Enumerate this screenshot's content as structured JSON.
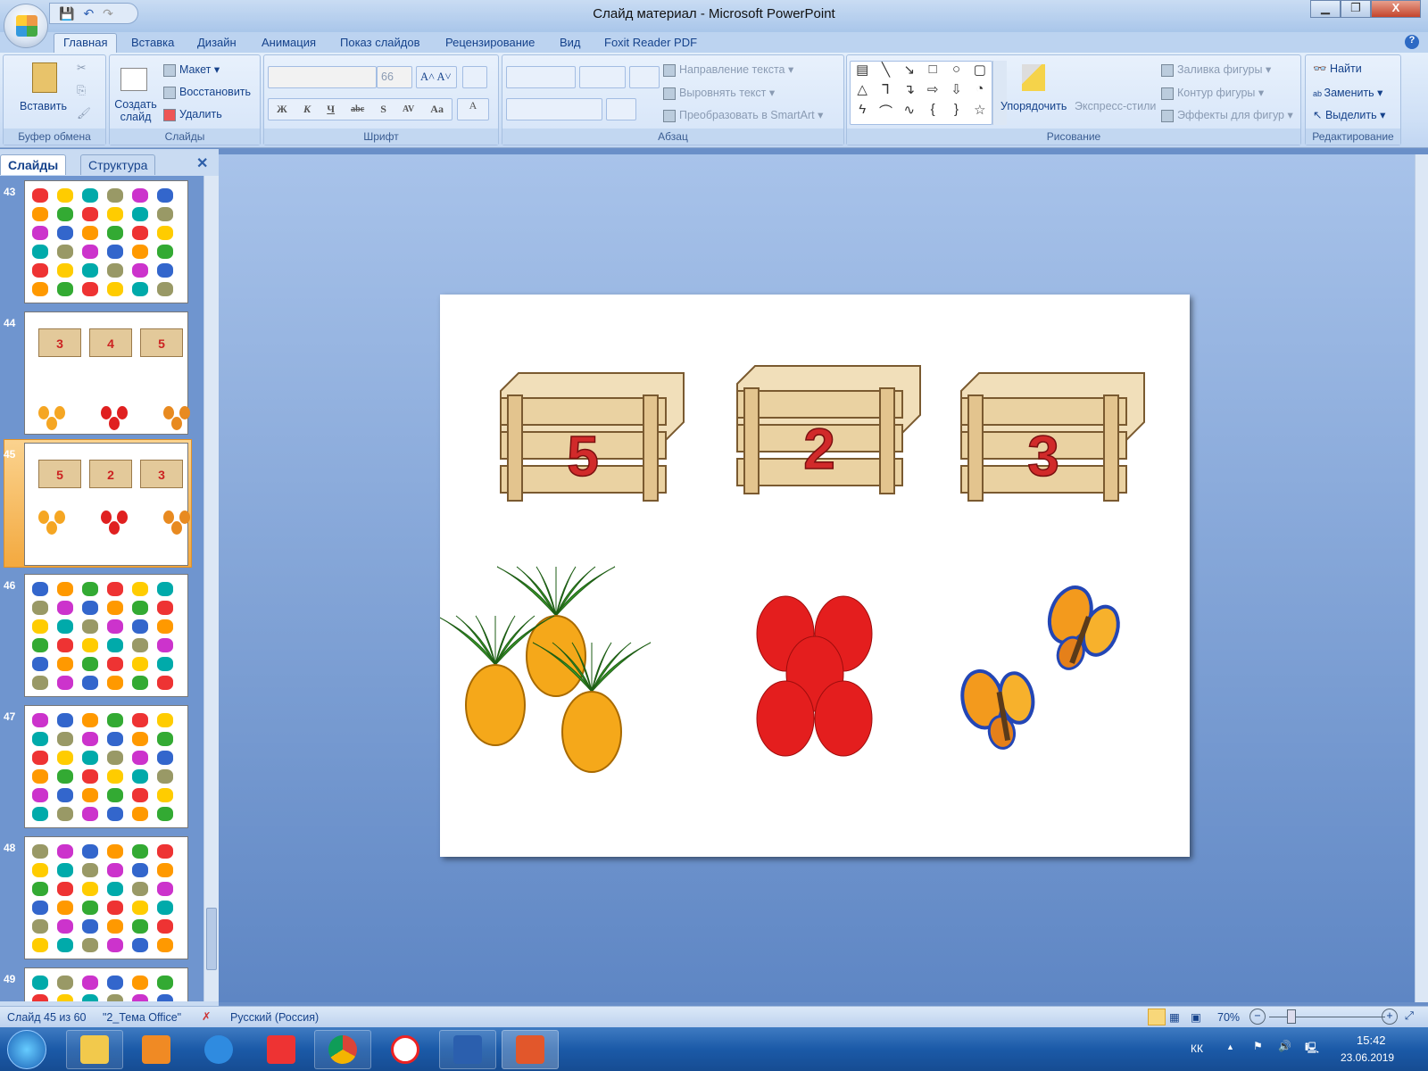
{
  "window": {
    "title": "Слайд материал - Microsoft PowerPoint"
  },
  "ribbon_tabs": [
    "Главная",
    "Вставка",
    "Дизайн",
    "Анимация",
    "Показ слайдов",
    "Рецензирование",
    "Вид",
    "Foxit Reader PDF"
  ],
  "ribbon": {
    "clipboard": {
      "paste": "Вставить",
      "label": "Буфер обмена"
    },
    "slides": {
      "new_slide": "Создать слайд",
      "layout": "Макет",
      "reset": "Восстановить",
      "delete": "Удалить",
      "label": "Слайды"
    },
    "font": {
      "size": "66",
      "label": "Шрифт",
      "buttons": [
        "Ж",
        "К",
        "Ч",
        "abc",
        "S",
        "AV",
        "Aa",
        "A"
      ]
    },
    "paragraph": {
      "text_direction": "Направление текста",
      "align_text": "Выровнять текст",
      "smartart": "Преобразовать в SmartArt",
      "label": "Абзац"
    },
    "drawing": {
      "arrange": "Упорядочить",
      "quick_styles": "Экспресс-стили",
      "fill": "Заливка фигуры",
      "outline": "Контур фигуры",
      "effects": "Эффекты для фигур",
      "label": "Рисование",
      "shapes": [
        "▤",
        "╲",
        "↘",
        "□",
        "○",
        "▢",
        "△",
        "⅂",
        "↴",
        "⇨",
        "⇩",
        "◔",
        "ϟ",
        "⌒",
        "∿",
        "{",
        "}",
        "☆"
      ]
    },
    "editing": {
      "find": "Найти",
      "replace": "Заменить",
      "select": "Выделить",
      "label": "Редактирование"
    }
  },
  "panel": {
    "tabs": [
      "Слайды",
      "Структура"
    ],
    "thumbnails": [
      {
        "num": "43"
      },
      {
        "num": "44",
        "crates": [
          "3",
          "4",
          "5"
        ]
      },
      {
        "num": "45",
        "crates": [
          "5",
          "2",
          "3"
        ],
        "selected": true
      },
      {
        "num": "46"
      },
      {
        "num": "47"
      },
      {
        "num": "48"
      },
      {
        "num": "49"
      }
    ]
  },
  "slide": {
    "crates": [
      "5",
      "2",
      "3"
    ],
    "number_color": "#d12a2a"
  },
  "status": {
    "slide": "Слайд 45 из 60",
    "theme": "\"2_Тема Office\"",
    "language": "Русский (Россия)",
    "zoom": "70%",
    "zoom_level": 70
  },
  "taskbar": {
    "lang": "КК",
    "time": "15:42",
    "date": "23.06.2019"
  }
}
